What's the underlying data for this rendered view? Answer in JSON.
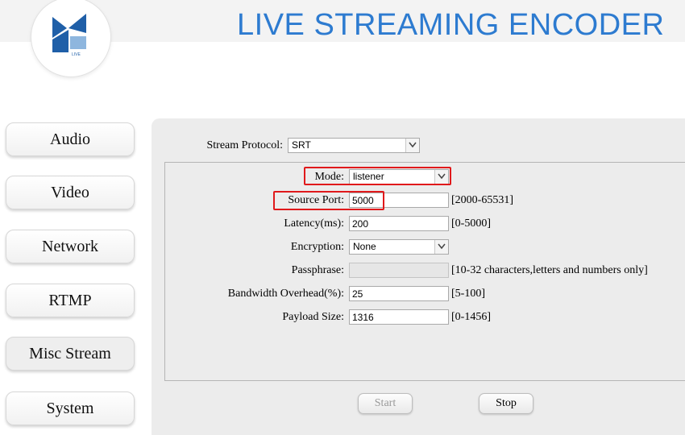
{
  "header": {
    "title": "LIVE STREAMING ENCODER",
    "logo_text": "LIVE"
  },
  "nav": {
    "items": [
      {
        "label": "Audio"
      },
      {
        "label": "Video"
      },
      {
        "label": "Network"
      },
      {
        "label": "RTMP"
      },
      {
        "label": "Misc Stream"
      },
      {
        "label": "System"
      }
    ],
    "active": "Misc Stream"
  },
  "form": {
    "protocol": {
      "label": "Stream Protocol:",
      "value": "SRT"
    },
    "mode": {
      "label": "Mode:",
      "value": "listener"
    },
    "source_port": {
      "label": "Source Port:",
      "value": "5000",
      "hint": "[2000-65531]"
    },
    "latency": {
      "label": "Latency(ms):",
      "value": "200",
      "hint": "[0-5000]"
    },
    "encryption": {
      "label": "Encryption:",
      "value": "None"
    },
    "passphrase": {
      "label": "Passphrase:",
      "value": "",
      "hint": "[10-32 characters,letters and numbers only]"
    },
    "bandwidth": {
      "label": "Bandwidth Overhead(%):",
      "value": "25",
      "hint": "[5-100]"
    },
    "payload": {
      "label": "Payload Size:",
      "value": "1316",
      "hint": "[0-1456]"
    }
  },
  "actions": {
    "start_label": "Start",
    "stop_label": "Stop"
  },
  "colors": {
    "title_blue": "#2d7bd0",
    "highlight_red": "#e0191b"
  }
}
